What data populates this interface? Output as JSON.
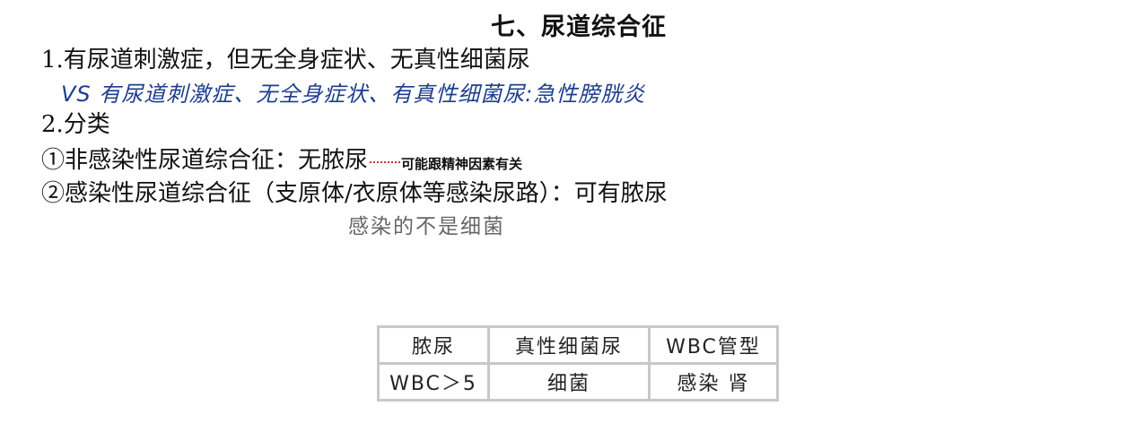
{
  "title": "七、尿道综合征",
  "lines": {
    "l1": "1.有尿道刺激症，但无全身症状、无真性细菌尿",
    "vs_note": "VS  有尿道刺激症、无全身症状、有真性细菌尿:急性膀胱炎",
    "l2": "2.分类",
    "l3": "①非感染性尿道综合征：无脓尿",
    "l3_note": "可能跟精神因素有关",
    "l4": "②感染性尿道综合征（支原体/衣原体等感染尿路）：可有脓尿",
    "l4_note": "感染的不是细菌"
  },
  "table": {
    "rows": [
      [
        "脓尿",
        "真性细菌尿",
        "WBC管型"
      ],
      [
        "WBC＞5",
        "细菌",
        "感染 肾"
      ]
    ]
  },
  "colors": {
    "handwriting_blue": "#1e3d8f",
    "handwriting_gray": "#666666",
    "dotted_leader": "#c0392b"
  }
}
